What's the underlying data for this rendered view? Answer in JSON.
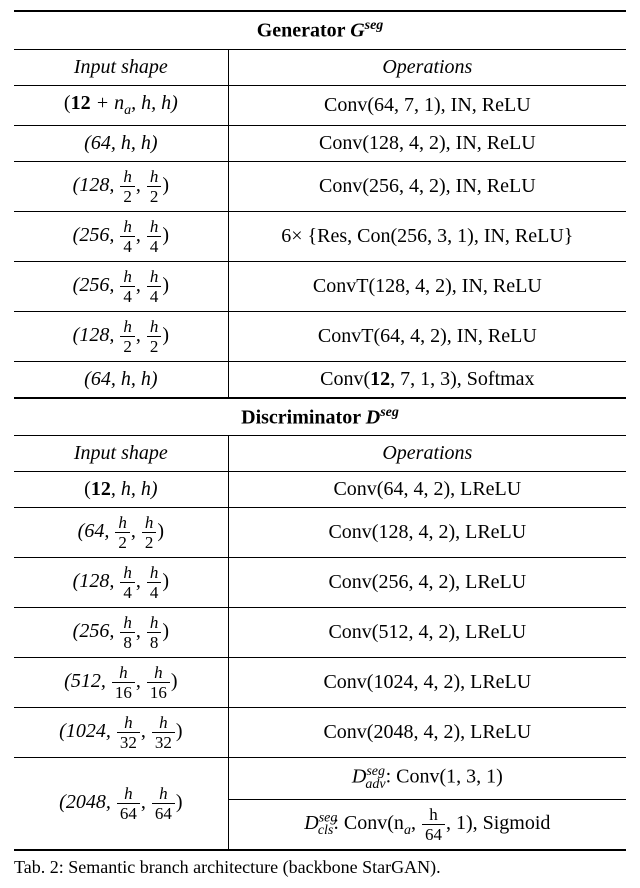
{
  "generator": {
    "title_prefix": "Generator ",
    "title_sym": "G",
    "title_sup": "seg",
    "col1": "Input shape",
    "col2": "Operations",
    "rows": [
      {
        "shape": {
          "pre": "(",
          "bold": "12",
          "mid": " + n",
          "sub": "a",
          "tail": ", h, h)"
        },
        "op": "Conv(64, 7, 1), IN, ReLU"
      },
      {
        "shape": {
          "txt": "(64, h, h)"
        },
        "op": "Conv(128, 4, 2), IN, ReLU"
      },
      {
        "shape": {
          "txt_frac": [
            "(128, ",
            "h",
            "2",
            ", ",
            "h",
            "2",
            ")"
          ]
        },
        "op": "Conv(256, 4, 2), IN, ReLU"
      },
      {
        "shape": {
          "txt_frac": [
            "(256, ",
            "h",
            "4",
            ", ",
            "h",
            "4",
            ")"
          ]
        },
        "op": "6× {Res, Con(256, 3, 1), IN, ReLU}"
      },
      {
        "shape": {
          "txt_frac": [
            "(256, ",
            "h",
            "4",
            ", ",
            "h",
            "4",
            ")"
          ]
        },
        "op": "ConvT(128, 4, 2), IN, ReLU"
      },
      {
        "shape": {
          "txt_frac": [
            "(128, ",
            "h",
            "2",
            ", ",
            "h",
            "2",
            ")"
          ]
        },
        "op": "ConvT(64, 4, 2), IN, ReLU"
      },
      {
        "shape": {
          "txt": "(64, h, h)"
        },
        "op_pre": "Conv(",
        "op_bold": "12",
        "op_post": ", 7, 1, 3), Softmax"
      }
    ]
  },
  "discriminator": {
    "title_prefix": "Discriminator ",
    "title_sym": "D",
    "title_sup": "seg",
    "col1": "Input shape",
    "col2": "Operations",
    "rows": [
      {
        "shape": {
          "pre": "(",
          "bold": "12",
          "tail": ", h, h)"
        },
        "op": "Conv(64, 4, 2), LReLU"
      },
      {
        "shape": {
          "txt_frac": [
            "(64, ",
            "h",
            "2",
            ", ",
            "h",
            "2",
            ")"
          ]
        },
        "op": "Conv(128, 4, 2), LReLU"
      },
      {
        "shape": {
          "txt_frac": [
            "(128, ",
            "h",
            "4",
            ", ",
            "h",
            "4",
            ")"
          ]
        },
        "op": "Conv(256, 4, 2), LReLU"
      },
      {
        "shape": {
          "txt_frac": [
            "(256, ",
            "h",
            "8",
            ", ",
            "h",
            "8",
            ")"
          ]
        },
        "op": "Conv(512, 4, 2), LReLU"
      },
      {
        "shape": {
          "txt_frac": [
            "(512, ",
            "h",
            "16",
            ", ",
            "h",
            "16",
            ")"
          ]
        },
        "op": "Conv(1024, 4, 2), LReLU"
      },
      {
        "shape": {
          "txt_frac": [
            "(1024, ",
            "h",
            "32",
            ", ",
            "h",
            "32",
            ")"
          ]
        },
        "op": "Conv(2048, 4, 2), LReLU"
      }
    ],
    "last_shape": {
      "txt_frac": [
        "(2048, ",
        "h",
        "64",
        ", ",
        "h",
        "64",
        ")"
      ]
    },
    "last_op1": {
      "sym": "D",
      "sub": "adv",
      "sup": "seg",
      "txt": ": Conv(1, 3, 1)"
    },
    "last_op2": {
      "sym": "D",
      "sub": "cls",
      "sup": "seg",
      "txt_pre": ": Conv(n",
      "na_sub": "a",
      "txt_mid": ", ",
      "frac_num": "h",
      "frac_den": "64",
      "txt_post": ", 1), Sigmoid"
    }
  },
  "caption": "Tab. 2: Semantic branch architecture (backbone StarGAN)."
}
